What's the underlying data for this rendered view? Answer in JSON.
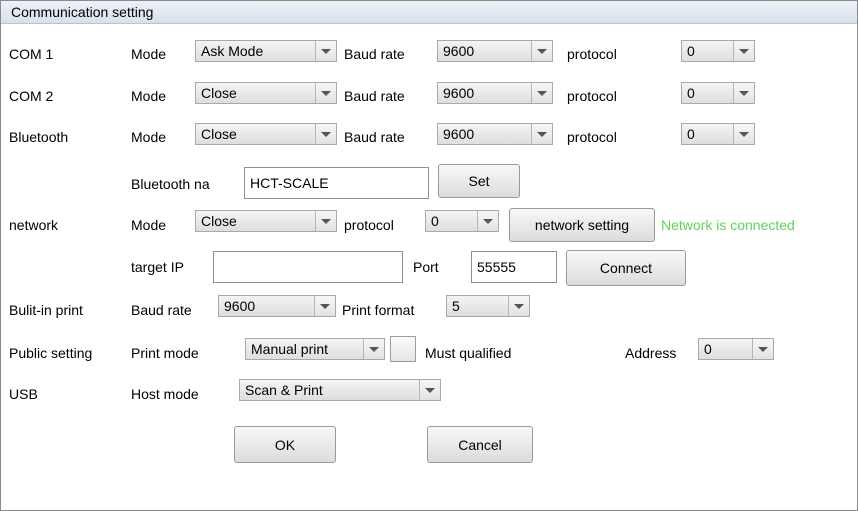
{
  "window": {
    "title": "Communication setting"
  },
  "com1": {
    "label": "COM 1",
    "mode_label": "Mode",
    "mode_value": "Ask Mode",
    "baud_label": "Baud rate",
    "baud_value": "9600",
    "protocol_label": "protocol",
    "protocol_value": "0"
  },
  "com2": {
    "label": "COM 2",
    "mode_label": "Mode",
    "mode_value": "Close",
    "baud_label": "Baud rate",
    "baud_value": "9600",
    "protocol_label": "protocol",
    "protocol_value": "0"
  },
  "bluetooth": {
    "label": "Bluetooth",
    "mode_label": "Mode",
    "mode_value": "Close",
    "baud_label": "Baud rate",
    "baud_value": "9600",
    "protocol_label": "protocol",
    "protocol_value": "0",
    "name_label": "Bluetooth na",
    "name_value": "HCT-SCALE",
    "set_button": "Set"
  },
  "network": {
    "label": "network",
    "mode_label": "Mode",
    "mode_value": "Close",
    "protocol_label": "protocol",
    "protocol_value": "0",
    "settings_button": "network setting",
    "status": "Network is connected",
    "status_color": "#5ed35e",
    "target_ip_label": "target IP",
    "target_ip_value": "",
    "port_label": "Port",
    "port_value": "55555",
    "connect_button": "Connect"
  },
  "builtin_print": {
    "label": "Bulit-in print",
    "baud_label": "Baud rate",
    "baud_value": "9600",
    "format_label": "Print format",
    "format_value": "5"
  },
  "public_setting": {
    "label": "Public setting",
    "print_mode_label": "Print mode",
    "print_mode_value": "Manual print",
    "must_qualified_label": "Must qualified",
    "address_label": "Address",
    "address_value": "0"
  },
  "usb": {
    "label": "USB",
    "host_mode_label": "Host mode",
    "host_mode_value": "Scan & Print"
  },
  "footer": {
    "ok_button": "OK",
    "cancel_button": "Cancel"
  }
}
